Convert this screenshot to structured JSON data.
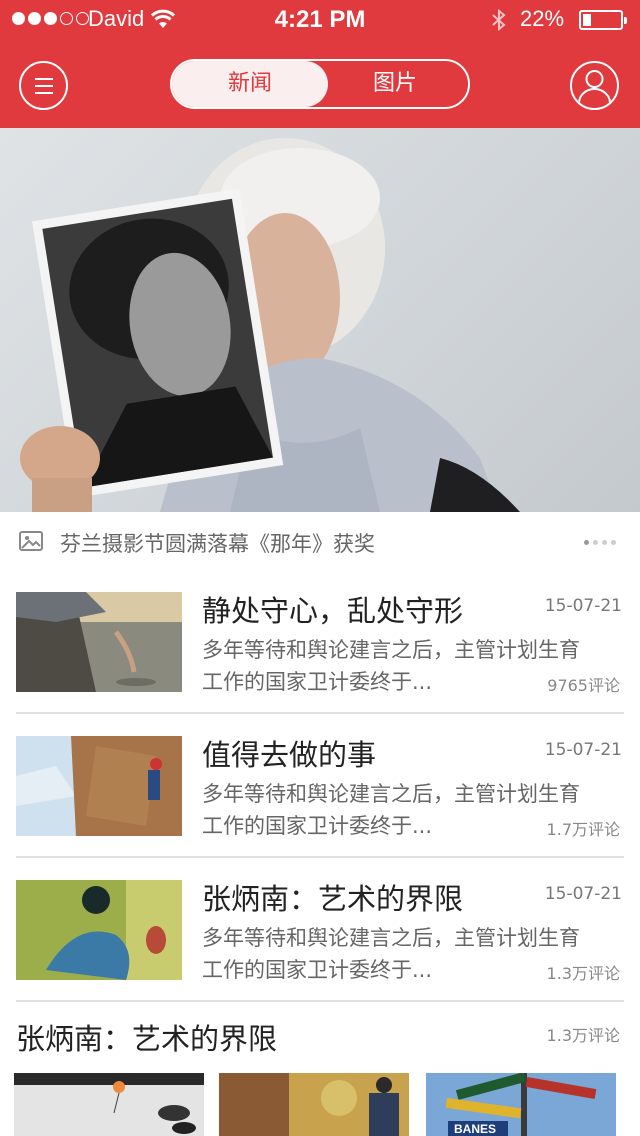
{
  "status_bar": {
    "carrier": "David",
    "time": "4:21 PM",
    "battery_percent": "22%",
    "battery_level": 0.22,
    "signal_bars_filled": 3,
    "signal_bars_total": 5
  },
  "nav": {
    "tabs": [
      {
        "label": "新闻",
        "active": true
      },
      {
        "label": "图片",
        "active": false
      }
    ]
  },
  "hero": {
    "caption": "芬兰摄影节圆满落幕《那年》获奖",
    "page_count": 4,
    "active_page": 0
  },
  "news": [
    {
      "title": "静处守心，乱处守形",
      "date": "15-07-21",
      "summary_line1": "多年等待和舆论建言之后，主管计划生育",
      "summary_line2": "工作的国家卫计委终于...",
      "comments": "9765评论"
    },
    {
      "title": "值得去做的事",
      "date": "15-07-21",
      "summary_line1": "多年等待和舆论建言之后，主管计划生育",
      "summary_line2": "工作的国家卫计委终于...",
      "comments": "1.7万评论"
    },
    {
      "title": "张炳南：艺术的界限",
      "date": "15-07-21",
      "summary_line1": "多年等待和舆论建言之后，主管计划生育",
      "summary_line2": "工作的国家卫计委终于...",
      "comments": "1.3万评论"
    }
  ],
  "gallery": {
    "title": "张炳南：艺术的界限",
    "comments": "1.3万评论",
    "sign_text": "BANES"
  },
  "colors": {
    "brand": "#e0393e",
    "active_tab_bg": "#fbeeee"
  }
}
